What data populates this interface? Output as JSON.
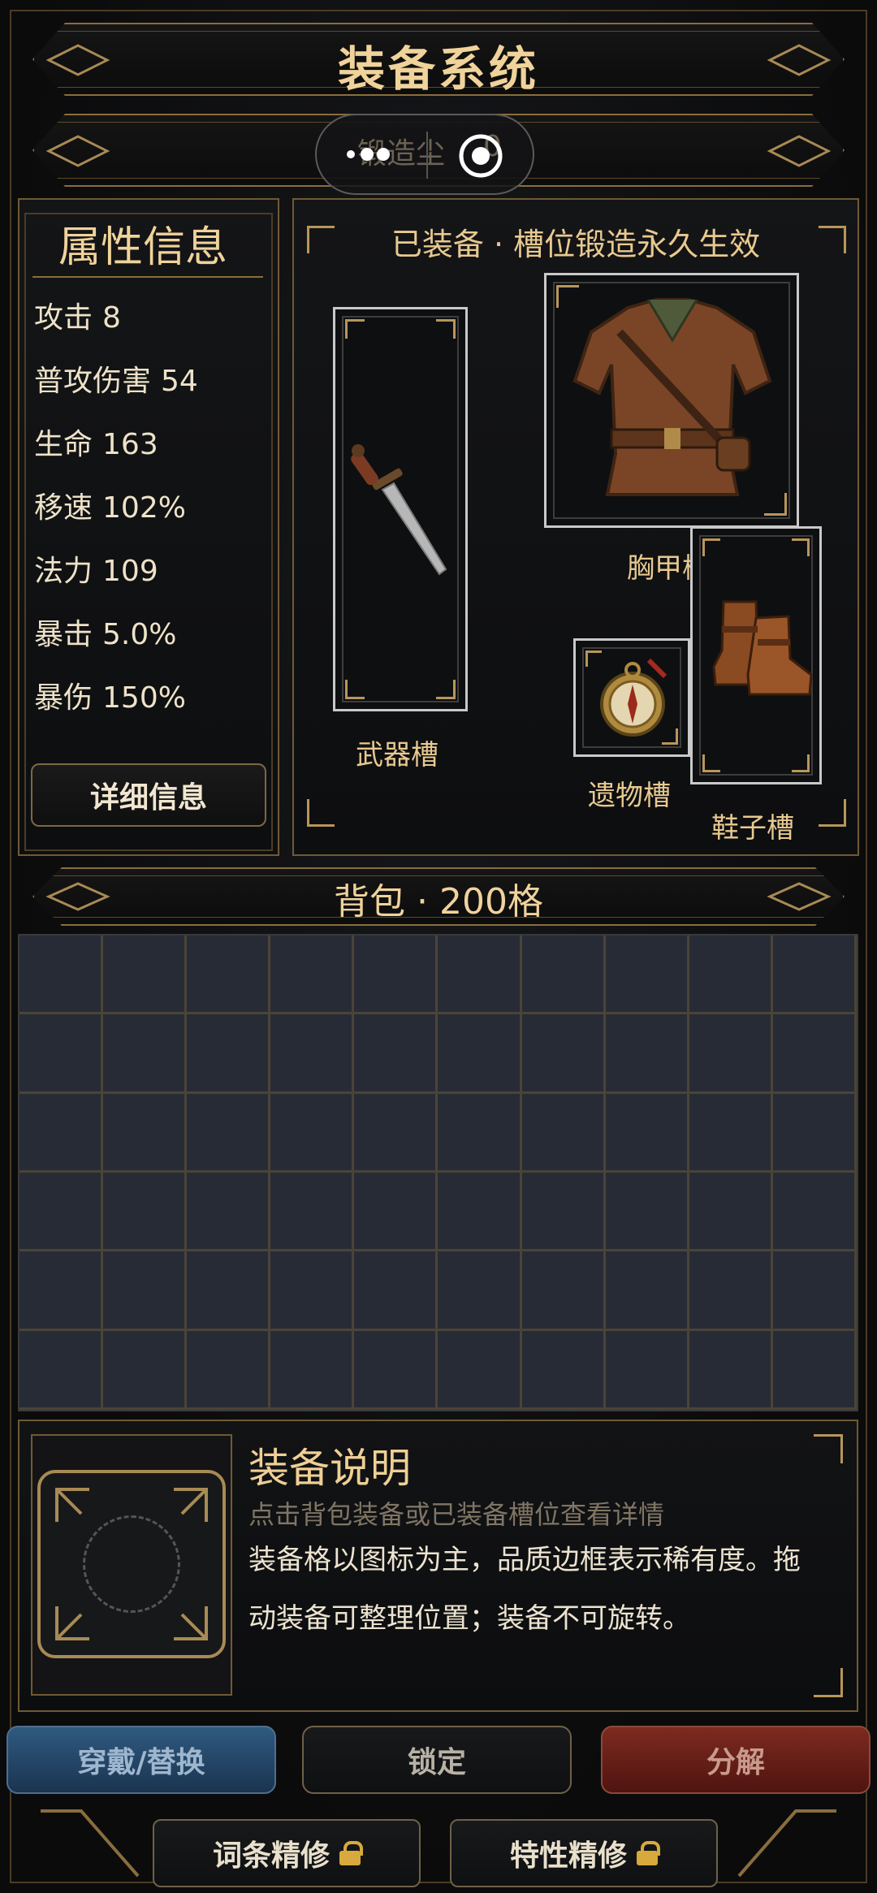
{
  "header": {
    "title": "装备系统"
  },
  "forge": {
    "label": "锻造尘",
    "value": "0"
  },
  "attributes": {
    "title": "属性信息",
    "stats": [
      {
        "name": "攻击",
        "value": "8"
      },
      {
        "name": "普攻伤害",
        "value": "54"
      },
      {
        "name": "生命",
        "value": "163"
      },
      {
        "name": "移速",
        "value": "102%"
      },
      {
        "name": "法力",
        "value": "109"
      },
      {
        "name": "暴击",
        "value": "5.0%"
      },
      {
        "name": "暴伤",
        "value": "150%"
      }
    ],
    "detail_button": "详细信息"
  },
  "equipped": {
    "title": "已装备 · 槽位锻造永久生效",
    "slots": {
      "weapon": "武器槽",
      "chest": "胸甲槽",
      "relic": "遗物槽",
      "boots": "鞋子槽"
    }
  },
  "bag": {
    "title": "背包 · 200格",
    "columns": 10,
    "visible_rows": 6
  },
  "description": {
    "title": "装备说明",
    "hint": "点击背包装备或已装备槽位查看详情",
    "line1": "装备格以图标为主，品质边框表示稀有度。拖",
    "line2": "动装备可整理位置；装备不可旋转。"
  },
  "actions": {
    "equip": "穿戴/替换",
    "lock": "锁定",
    "salvage": "分解"
  },
  "refine": {
    "affix": "词条精修",
    "trait": "特性精修"
  },
  "colors": {
    "gold": "#e8c98f",
    "equip_button": "#274867",
    "salvage_button": "#6b1f17"
  }
}
